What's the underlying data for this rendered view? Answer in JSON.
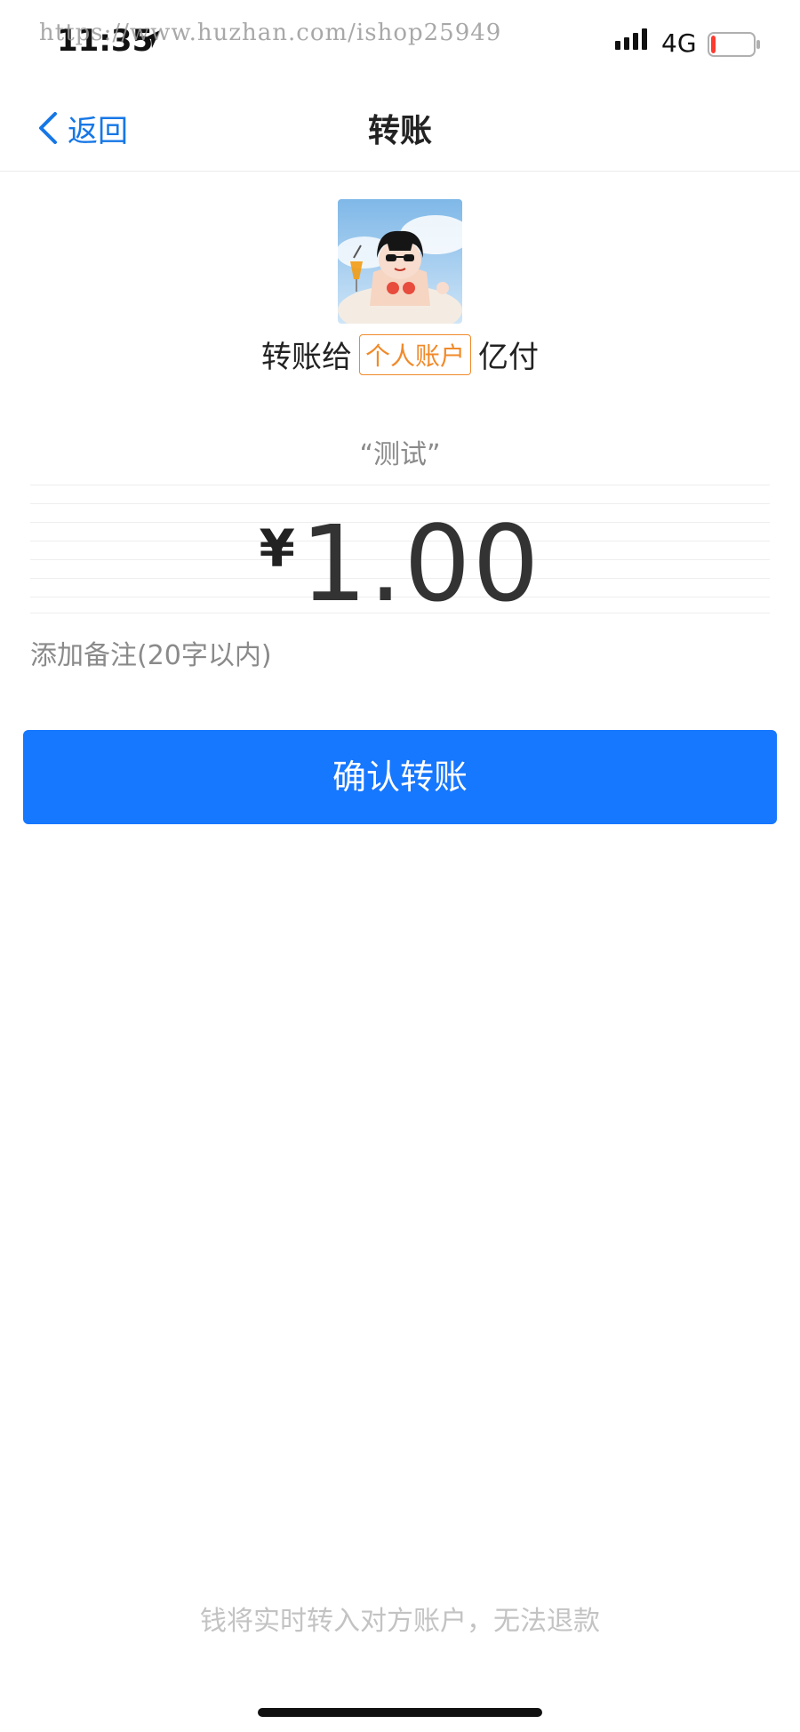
{
  "status_bar": {
    "time": "11:35",
    "network": "4G",
    "watermark": "https://www.huzhan.com/ishop25949",
    "battery_level": 0.1,
    "battery_color": "#ff3b30"
  },
  "nav": {
    "back_label": "返回",
    "title": "转账"
  },
  "recipient": {
    "prefix": "转账给",
    "account_type": "个人账户",
    "name": "亿付"
  },
  "note_quote": "“测试”",
  "amount": {
    "currency": "¥",
    "value": "1.00"
  },
  "remark_placeholder": "添加备注(20字以内)",
  "confirm_label": "确认转账",
  "footer_note": "钱将实时转入对方账户，无法退款",
  "colors": {
    "accent": "#1677ff",
    "link": "#1677e6",
    "badge": "#f08a2a"
  }
}
